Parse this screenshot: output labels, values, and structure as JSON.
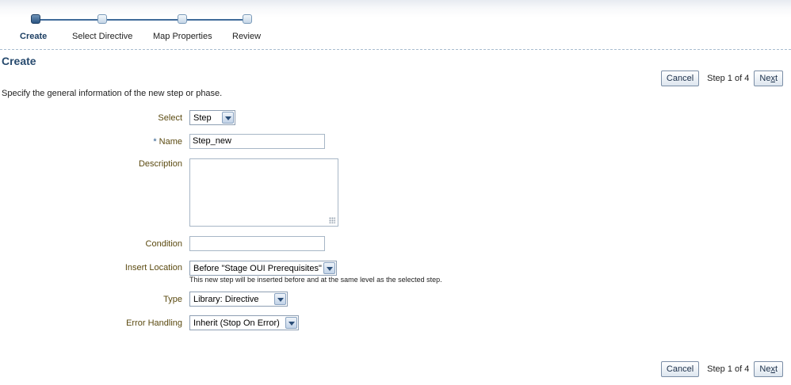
{
  "train": {
    "steps": [
      {
        "label": "Create",
        "active": true
      },
      {
        "label": "Select Directive",
        "active": false
      },
      {
        "label": "Map Properties",
        "active": false
      },
      {
        "label": "Review",
        "active": false
      }
    ]
  },
  "page": {
    "title": "Create",
    "instruction": "Specify the general information of the new step or phase."
  },
  "nav": {
    "cancel_label": "Cancel",
    "step_text": "Step 1 of 4",
    "next_label_before": "Ne",
    "next_label_underlined": "x",
    "next_label_after": "t"
  },
  "form": {
    "select": {
      "label": "Select",
      "value": "Step"
    },
    "name": {
      "required_mark": "*",
      "label": "Name",
      "value": "Step_new"
    },
    "description": {
      "label": "Description",
      "value": ""
    },
    "condition": {
      "label": "Condition",
      "value": ""
    },
    "insert_location": {
      "label": "Insert Location",
      "value": "Before \"Stage OUI Prerequisites\"",
      "hint": "This new step will be inserted before and at the same level as the selected step."
    },
    "type": {
      "label": "Type",
      "value": "Library: Directive"
    },
    "error_handling": {
      "label": "Error Handling",
      "value": "Inherit (Stop On Error)"
    }
  },
  "icons": {
    "dropdown": "chevron-down-icon",
    "resize": "resize-grip-icon",
    "train_node": "train-stop-icon"
  },
  "colors": {
    "accent": "#274a6e",
    "label": "#5b4a10",
    "active_node": "#2b5582"
  }
}
